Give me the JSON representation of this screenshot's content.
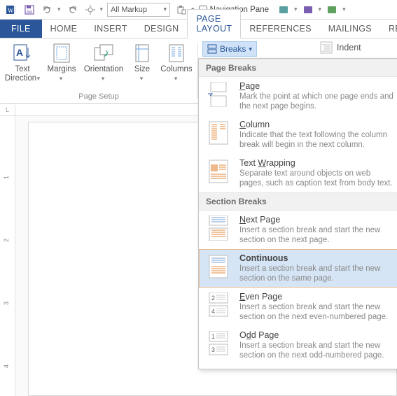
{
  "qat": {
    "markup_value": "All Markup",
    "navpane_label": "Navigation Pane"
  },
  "tabs": {
    "file": "FILE",
    "home": "HOME",
    "insert": "INSERT",
    "design": "DESIGN",
    "page_layout": "PAGE LAYOUT",
    "references": "REFERENCES",
    "mailings": "MAILINGS",
    "review_partial": "RE"
  },
  "ribbon": {
    "text_direction": "Text\nDirection",
    "margins": "Margins",
    "orientation": "Orientation",
    "size": "Size",
    "columns": "Columns",
    "group_label": "Page Setup",
    "breaks_label": "Breaks",
    "indent_label": "Indent"
  },
  "dropdown": {
    "hdr_page": "Page Breaks",
    "hdr_section": "Section Breaks",
    "page": {
      "title_u": "P",
      "title_rest": "age",
      "desc": "Mark the point at which one page ends and the next page begins."
    },
    "column": {
      "title_u": "C",
      "title_rest": "olumn",
      "desc": "Indicate that the text following the column break will begin in the next column."
    },
    "textwrap": {
      "title_pre": "Text ",
      "title_u": "W",
      "title_rest": "rapping",
      "desc": "Separate text around objects on web pages, such as caption text from body text."
    },
    "nextpage": {
      "title_u": "N",
      "title_rest": "ext Page",
      "desc": "Insert a section break and start the new section on the next page."
    },
    "continuous": {
      "title": "Continuous",
      "desc": "Insert a section break and start the new section on the same page."
    },
    "evenpage": {
      "title_u": "E",
      "title_rest": "ven Page",
      "desc": "Insert a section break and start the new section on the next even-numbered page."
    },
    "oddpage": {
      "title_pre": "O",
      "title_u": "d",
      "title_rest": "d Page",
      "desc": "Insert a section break and start the new section on the next odd-numbered page."
    }
  },
  "ruler": {
    "corner": "L",
    "t1": "1",
    "t2": "2",
    "t3": "3",
    "t4": "4"
  }
}
